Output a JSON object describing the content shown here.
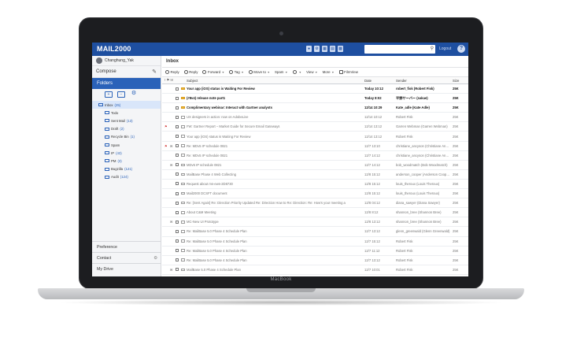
{
  "device": {
    "brand": "MacBook"
  },
  "app": {
    "name": "MAIL2000"
  },
  "header": {
    "icons": [
      "person-icon",
      "gear-icon",
      "calendar-icon",
      "contacts-icon",
      "grid-icon"
    ],
    "search_placeholder": "",
    "logout_label": "Logout",
    "help_label": "?"
  },
  "sidebar": {
    "user": "Changhung_Yak",
    "compose_label": "Compose",
    "folders_label": "Folders",
    "folder_items": [
      {
        "label": "Inbox",
        "count": "(25)"
      },
      {
        "label": "Todo",
        "count": ""
      },
      {
        "label": "Sent Mail",
        "count": "(13)"
      },
      {
        "label": "Draft",
        "count": "(2)"
      },
      {
        "label": "Recycle Bin",
        "count": "(1)"
      },
      {
        "label": "Spam",
        "count": ""
      },
      {
        "label": "IP",
        "count": "(43)"
      },
      {
        "label": "PM",
        "count": "(3)"
      },
      {
        "label": "Bugzilla",
        "count": "(121)"
      },
      {
        "label": "Audit",
        "count": "(124)"
      }
    ],
    "preference_label": "Preference",
    "contact_label": "Contact",
    "mydrive_label": "My Drive"
  },
  "main": {
    "title": "Inbox",
    "toolbar": {
      "reply": "Reply",
      "reply_all": "Reply",
      "forward": "Forward",
      "tag": "Tag",
      "move_to": "Move to",
      "spam": "Spam",
      "view": "View",
      "more": "More",
      "filmview": "FilmView"
    },
    "columns": {
      "flags": "! ⚑ ✉",
      "subject": "Subject",
      "date": "Date",
      "sender": "Sender",
      "size": "Size"
    },
    "rows": [
      {
        "subject": "Your app (iOS) status is Waiting For Review",
        "date": "Today 10:12",
        "sender": "robert_fisk (Robert Fisk)",
        "size": "25K",
        "unread": true,
        "flag": false,
        "attach": false
      },
      {
        "subject": "(#8v4) release note part1",
        "date": "Today 8:02",
        "sender": "平野サーバー (sakae)",
        "size": "25K",
        "unread": true,
        "flag": false,
        "attach": false
      },
      {
        "subject": "Complimentary webinar: Interact with Gartner analysts",
        "date": "12/14 10:29",
        "sender": "Kate_adle (Kate Adle)",
        "size": "25K",
        "unread": true,
        "flag": false,
        "attach": false
      },
      {
        "subject": "UX designers in action: now on AdobeLive",
        "date": "12/14 10:12",
        "sender": "Robert Fisk",
        "size": "25K",
        "unread": false,
        "flag": false,
        "attach": false
      },
      {
        "subject": "FW: Gartner Report – Market Guide for Secure Email Gateways",
        "date": "12/14 13:12",
        "sender": "Garren Webman (Garren Webman)",
        "size": "25K",
        "unread": false,
        "flag": true,
        "attach": false
      },
      {
        "subject": "Your app (iOS) status is Waiting For Review",
        "date": "12/14 13:12",
        "sender": "Robert Fisk",
        "size": "25K",
        "unread": false,
        "flag": false,
        "attach": false
      },
      {
        "subject": "Re: MDv5 IP schedule 0821",
        "date": "12/7 13:10",
        "sender": "christiane_ancyson (Christiane Ancer",
        "size": "25K",
        "unread": false,
        "flag": true,
        "attach": true
      },
      {
        "subject": "Re: MDv5 IP schedule 0821",
        "date": "12/7 14:12",
        "sender": "christiane_ancyson (Christiane Ancer",
        "size": "25K",
        "unread": false,
        "flag": false,
        "attach": false
      },
      {
        "subject": "MDv5 IP schedule 0821",
        "date": "12/7 14:12",
        "sender": "bob_woodmatch (Bob Woodmatch)",
        "size": "25K",
        "unread": false,
        "flag": false,
        "attach": true
      },
      {
        "subject": "MailBase Phase 4 Web Collecting",
        "date": "12/8 15:12",
        "sender": "anderson_cooper (Anderson Cooper)",
        "size": "25K",
        "unread": false,
        "flag": false,
        "attach": false
      },
      {
        "subject": "Request about ms-ews-2D8730",
        "date": "12/8 15:12",
        "sender": "louis_theroux (Louis Theroux)",
        "size": "25K",
        "unread": false,
        "flag": false,
        "attach": false
      },
      {
        "subject": "Mail2000 DCSFT document",
        "date": "12/8 15:12",
        "sender": "louis_theroux (Louis Theroux)",
        "size": "25K",
        "unread": false,
        "flag": false,
        "attach": false
      },
      {
        "subject": "Re: [Sent Again] Re: Direction Priority Updated Re: Direction How to Re: Direction: Re: How's your meeting a",
        "date": "12/8 04:12",
        "sender": "diana_sawyer (Diana Sawyer)",
        "size": "25K",
        "unread": false,
        "flag": false,
        "attach": false
      },
      {
        "subject": "About C&M Meeting",
        "date": "12/8 8:12",
        "sender": "shannon_bree (Shannon Bree)",
        "size": "25K",
        "unread": false,
        "flag": false,
        "attach": false
      },
      {
        "subject": "MC-New UI Prototype",
        "date": "12/8 13:12",
        "sender": "shannon_bree (Shannon Bree)",
        "size": "25K",
        "unread": false,
        "flag": false,
        "attach": true
      },
      {
        "subject": "Re: MailBase 5.0 Phase 4 Schedule Plan",
        "date": "12/7 13:12",
        "sender": "glenn_greenwald (Glenn Greenwald)",
        "size": "25K",
        "unread": false,
        "flag": false,
        "attach": false
      },
      {
        "subject": "Re: MailBase 5.0 Phase 4 Schedule Plan",
        "date": "12/7 15:12",
        "sender": "Robert Fisk",
        "size": "25K",
        "unread": false,
        "flag": false,
        "attach": false
      },
      {
        "subject": "Re: MailBase 5.0 Phase 4 Schedule Plan",
        "date": "12/7 11:12",
        "sender": "Robert Fisk",
        "size": "25K",
        "unread": false,
        "flag": false,
        "attach": false
      },
      {
        "subject": "Re: MailBase 5.0 Phase 4 Schedule Plan",
        "date": "12/7 13:12",
        "sender": "Robert Fisk",
        "size": "25K",
        "unread": false,
        "flag": false,
        "attach": false
      },
      {
        "subject": "MailBase 5.0 Phase 4 Schedule Plan",
        "date": "12/7 10:01",
        "sender": "Robert Fisk",
        "size": "25K",
        "unread": false,
        "flag": false,
        "attach": true
      }
    ]
  }
}
